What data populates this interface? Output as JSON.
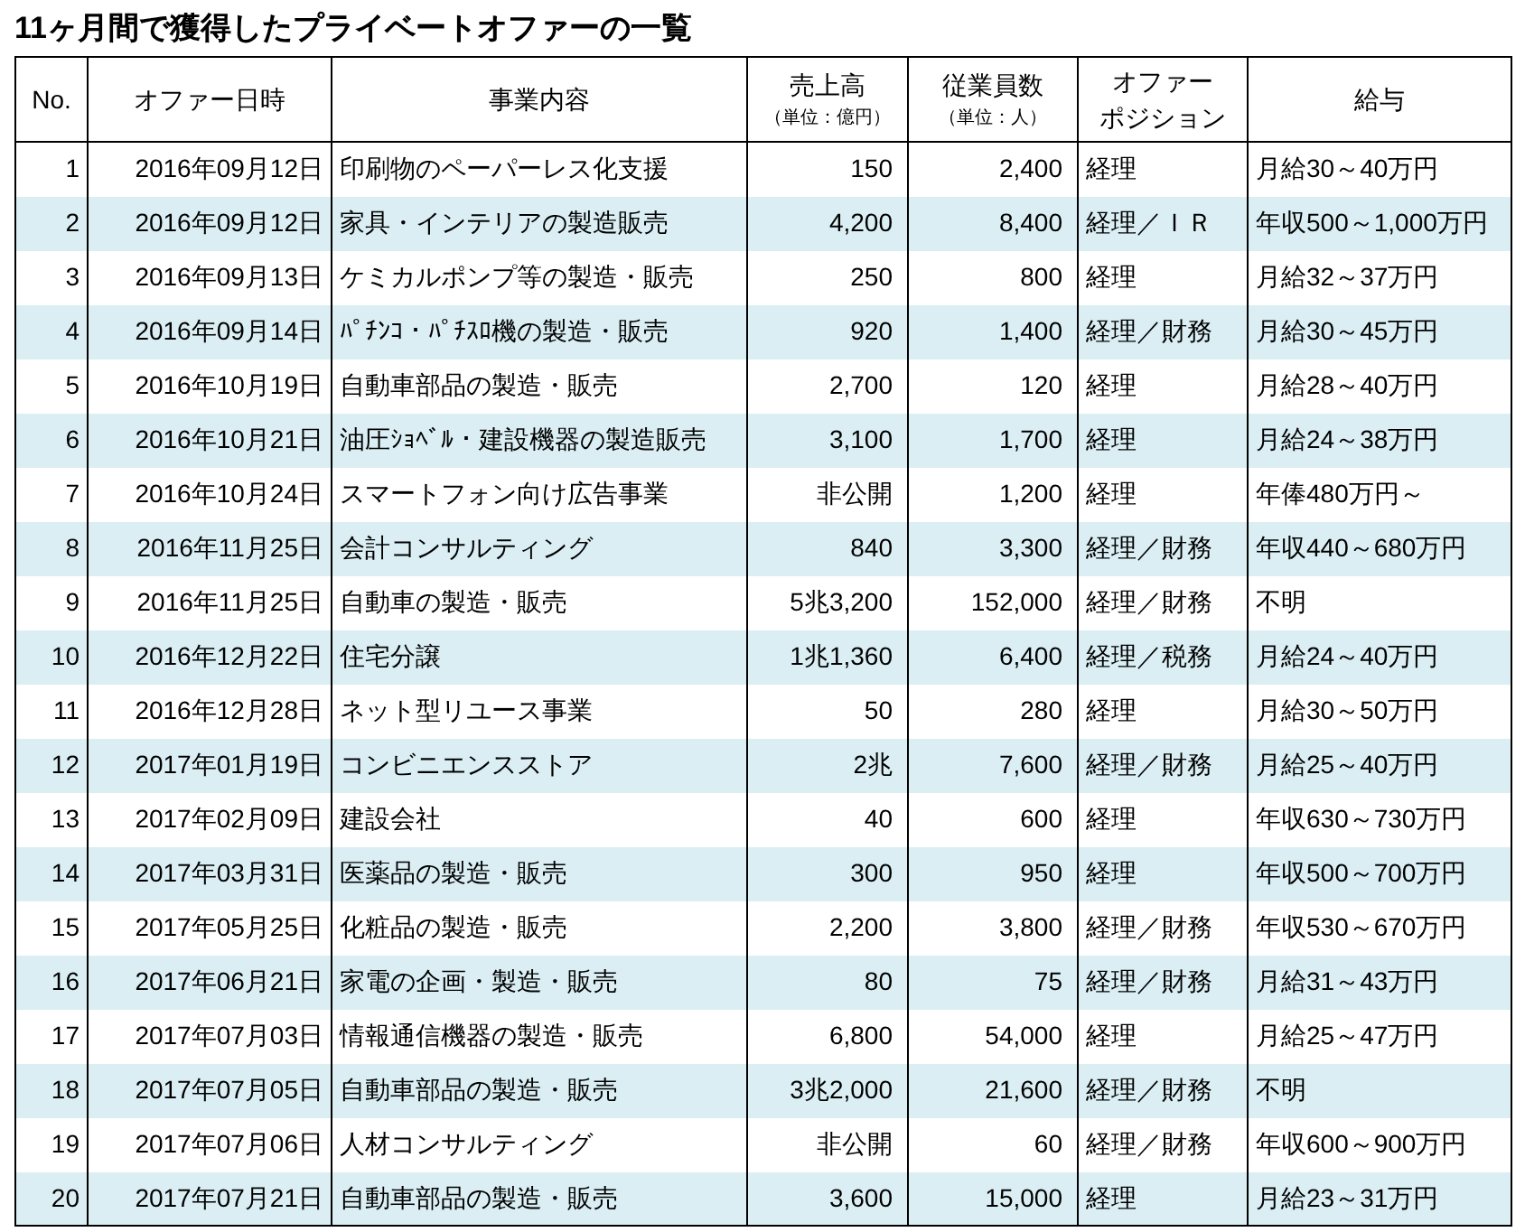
{
  "title": "11ヶ月間で獲得したプライベートオファーの一覧",
  "table": {
    "columns": [
      {
        "label_lines": [
          "No."
        ]
      },
      {
        "label_lines": [
          "オファー日時"
        ]
      },
      {
        "label_lines": [
          "事業内容"
        ]
      },
      {
        "label_lines": [
          "売上高"
        ],
        "unit": "（単位：億円）"
      },
      {
        "label_lines": [
          "従業員数"
        ],
        "unit": "（単位：人）"
      },
      {
        "label_lines": [
          "オファー",
          "ポジション"
        ]
      },
      {
        "label_lines": [
          "給与"
        ]
      }
    ],
    "rows": [
      [
        "1",
        "2016年09月12日",
        "印刷物のペーパーレス化支援",
        "150",
        "2,400",
        "経理",
        "月給30～40万円"
      ],
      [
        "2",
        "2016年09月12日",
        "家具・インテリアの製造販売",
        "4,200",
        "8,400",
        "経理／ＩＲ",
        "年収500～1,000万円"
      ],
      [
        "3",
        "2016年09月13日",
        "ケミカルポンプ等の製造・販売",
        "250",
        "800",
        "経理",
        "月給32～37万円"
      ],
      [
        "4",
        "2016年09月14日",
        "ﾊﾟﾁﾝｺ・ﾊﾟﾁｽﾛ機の製造・販売",
        "920",
        "1,400",
        "経理／財務",
        "月給30～45万円"
      ],
      [
        "5",
        "2016年10月19日",
        "自動車部品の製造・販売",
        "2,700",
        "120",
        "経理",
        "月給28～40万円"
      ],
      [
        "6",
        "2016年10月21日",
        "油圧ｼｮﾍﾞﾙ・建設機器の製造販売",
        "3,100",
        "1,700",
        "経理",
        "月給24～38万円"
      ],
      [
        "7",
        "2016年10月24日",
        "スマートフォン向け広告事業",
        "非公開",
        "1,200",
        "経理",
        "年俸480万円～"
      ],
      [
        "8",
        "2016年11月25日",
        "会計コンサルティング",
        "840",
        "3,300",
        "経理／財務",
        "年収440～680万円"
      ],
      [
        "9",
        "2016年11月25日",
        "自動車の製造・販売",
        "5兆3,200",
        "152,000",
        "経理／財務",
        "不明"
      ],
      [
        "10",
        "2016年12月22日",
        "住宅分譲",
        "1兆1,360",
        "6,400",
        "経理／税務",
        "月給24～40万円"
      ],
      [
        "11",
        "2016年12月28日",
        "ネット型リユース事業",
        "50",
        "280",
        "経理",
        "月給30～50万円"
      ],
      [
        "12",
        "2017年01月19日",
        "コンビニエンスストア",
        "2兆",
        "7,600",
        "経理／財務",
        "月給25～40万円"
      ],
      [
        "13",
        "2017年02月09日",
        "建設会社",
        "40",
        "600",
        "経理",
        "年収630～730万円"
      ],
      [
        "14",
        "2017年03月31日",
        "医薬品の製造・販売",
        "300",
        "950",
        "経理",
        "年収500～700万円"
      ],
      [
        "15",
        "2017年05月25日",
        "化粧品の製造・販売",
        "2,200",
        "3,800",
        "経理／財務",
        "年収530～670万円"
      ],
      [
        "16",
        "2017年06月21日",
        "家電の企画・製造・販売",
        "80",
        "75",
        "経理／財務",
        "月給31～43万円"
      ],
      [
        "17",
        "2017年07月03日",
        "情報通信機器の製造・販売",
        "6,800",
        "54,000",
        "経理",
        "月給25～47万円"
      ],
      [
        "18",
        "2017年07月05日",
        "自動車部品の製造・販売",
        "3兆2,000",
        "21,600",
        "経理／財務",
        "不明"
      ],
      [
        "19",
        "2017年07月06日",
        "人材コンサルティング",
        "非公開",
        "60",
        "経理／財務",
        "年収600～900万円"
      ],
      [
        "20",
        "2017年07月21日",
        "自動車部品の製造・販売",
        "3,600",
        "15,000",
        "経理",
        "月給23～31万円"
      ]
    ]
  }
}
